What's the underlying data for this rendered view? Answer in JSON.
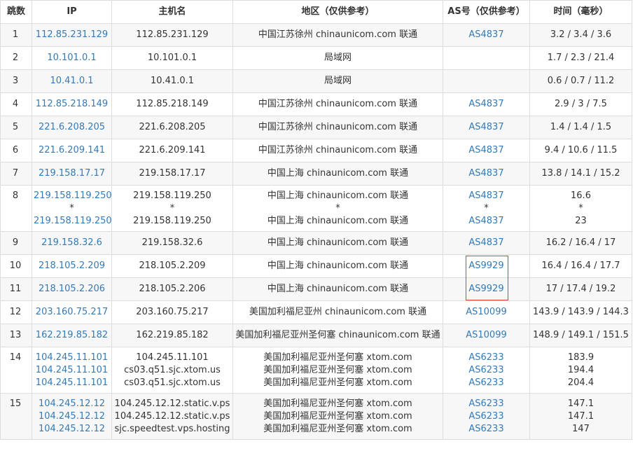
{
  "headers": {
    "hop": "跳数",
    "ip": "IP",
    "host": "主机名",
    "region": "地区（仅供参考）",
    "as": "AS号（仅供参考）",
    "time": "时间（毫秒）"
  },
  "rows": [
    {
      "hop": "1",
      "ip": [
        "112.85.231.129"
      ],
      "host": [
        "112.85.231.129"
      ],
      "region": [
        "中国江苏徐州 chinaunicom.com 联通"
      ],
      "as": [
        "AS4837"
      ],
      "time": [
        "3.2 / 3.4 / 3.6"
      ]
    },
    {
      "hop": "2",
      "ip": [
        "10.101.0.1"
      ],
      "host": [
        "10.101.0.1"
      ],
      "region": [
        "局域网"
      ],
      "as": [
        ""
      ],
      "time": [
        "1.7 / 2.3 / 21.4"
      ]
    },
    {
      "hop": "3",
      "ip": [
        "10.41.0.1"
      ],
      "host": [
        "10.41.0.1"
      ],
      "region": [
        "局域网"
      ],
      "as": [
        ""
      ],
      "time": [
        "0.6 / 0.7 / 11.2"
      ]
    },
    {
      "hop": "4",
      "ip": [
        "112.85.218.149"
      ],
      "host": [
        "112.85.218.149"
      ],
      "region": [
        "中国江苏徐州 chinaunicom.com 联通"
      ],
      "as": [
        "AS4837"
      ],
      "time": [
        "2.9 / 3 / 7.5"
      ]
    },
    {
      "hop": "5",
      "ip": [
        "221.6.208.205"
      ],
      "host": [
        "221.6.208.205"
      ],
      "region": [
        "中国江苏徐州 chinaunicom.com 联通"
      ],
      "as": [
        "AS4837"
      ],
      "time": [
        "1.4 / 1.4 / 1.5"
      ]
    },
    {
      "hop": "6",
      "ip": [
        "221.6.209.141"
      ],
      "host": [
        "221.6.209.141"
      ],
      "region": [
        "中国江苏徐州 chinaunicom.com 联通"
      ],
      "as": [
        "AS4837"
      ],
      "time": [
        "9.4 / 10.6 / 11.5"
      ]
    },
    {
      "hop": "7",
      "ip": [
        "219.158.17.17"
      ],
      "host": [
        "219.158.17.17"
      ],
      "region": [
        "中国上海 chinaunicom.com 联通"
      ],
      "as": [
        "AS4837"
      ],
      "time": [
        "13.8 / 14.1 / 15.2"
      ]
    },
    {
      "hop": "8",
      "ip": [
        "219.158.119.250",
        "*",
        "219.158.119.250"
      ],
      "host": [
        "219.158.119.250",
        "*",
        "219.158.119.250"
      ],
      "region": [
        "中国上海 chinaunicom.com 联通",
        "*",
        "中国上海 chinaunicom.com 联通"
      ],
      "as": [
        "AS4837",
        "*",
        "AS4837"
      ],
      "time": [
        "16.6",
        "*",
        "23"
      ]
    },
    {
      "hop": "9",
      "ip": [
        "219.158.32.6"
      ],
      "host": [
        "219.158.32.6"
      ],
      "region": [
        "中国上海 chinaunicom.com 联通"
      ],
      "as": [
        "AS4837"
      ],
      "time": [
        "16.2 / 16.4 / 17"
      ]
    },
    {
      "hop": "10",
      "ip": [
        "218.105.2.209"
      ],
      "host": [
        "218.105.2.209"
      ],
      "region": [
        "中国上海 chinaunicom.com 联通"
      ],
      "as": [
        "AS9929"
      ],
      "time": [
        "16.4 / 16.4 / 17.7"
      ]
    },
    {
      "hop": "11",
      "ip": [
        "218.105.2.206"
      ],
      "host": [
        "218.105.2.206"
      ],
      "region": [
        "中国上海 chinaunicom.com 联通"
      ],
      "as": [
        "AS9929"
      ],
      "time": [
        "17 / 17.4 / 19.2"
      ]
    },
    {
      "hop": "12",
      "ip": [
        "203.160.75.217"
      ],
      "host": [
        "203.160.75.217"
      ],
      "region": [
        "美国加利福尼亚州 chinaunicom.com 联通"
      ],
      "as": [
        "AS10099"
      ],
      "time": [
        "143.9 / 143.9 / 144.3"
      ]
    },
    {
      "hop": "13",
      "ip": [
        "162.219.85.182"
      ],
      "host": [
        "162.219.85.182"
      ],
      "region": [
        "美国加利福尼亚州圣何塞 chinaunicom.com 联通"
      ],
      "as": [
        "AS10099"
      ],
      "time": [
        "148.9 / 149.1 / 151.5"
      ]
    },
    {
      "hop": "14",
      "ip": [
        "104.245.11.101",
        "104.245.11.101",
        "104.245.11.101"
      ],
      "host": [
        "104.245.11.101",
        "cs03.q51.sjc.xtom.us",
        "cs03.q51.sjc.xtom.us"
      ],
      "region": [
        "美国加利福尼亚州圣何塞 xtom.com",
        "美国加利福尼亚州圣何塞 xtom.com",
        "美国加利福尼亚州圣何塞 xtom.com"
      ],
      "as": [
        "AS6233",
        "AS6233",
        "AS6233"
      ],
      "time": [
        "183.9",
        "194.4",
        "204.4"
      ]
    },
    {
      "hop": "15",
      "ip": [
        "104.245.12.12",
        "104.245.12.12",
        "104.245.12.12"
      ],
      "host": [
        "104.245.12.12.static.v.ps",
        "104.245.12.12.static.v.ps",
        "sjc.speedtest.vps.hosting"
      ],
      "region": [
        "美国加利福尼亚州圣何塞 xtom.com",
        "美国加利福尼亚州圣何塞 xtom.com",
        "美国加利福尼亚州圣何塞 xtom.com"
      ],
      "as": [
        "AS6233",
        "AS6233",
        "AS6233"
      ],
      "time": [
        "147.1",
        "147.1",
        "147"
      ]
    }
  ],
  "highlight": {
    "rows": [
      "10",
      "11"
    ],
    "column": "as",
    "color": "#e33b3b"
  },
  "colors": {
    "link": "#337ab7",
    "text": "#333333",
    "stripe": "#f7f7f7",
    "border": "#dddddd"
  }
}
